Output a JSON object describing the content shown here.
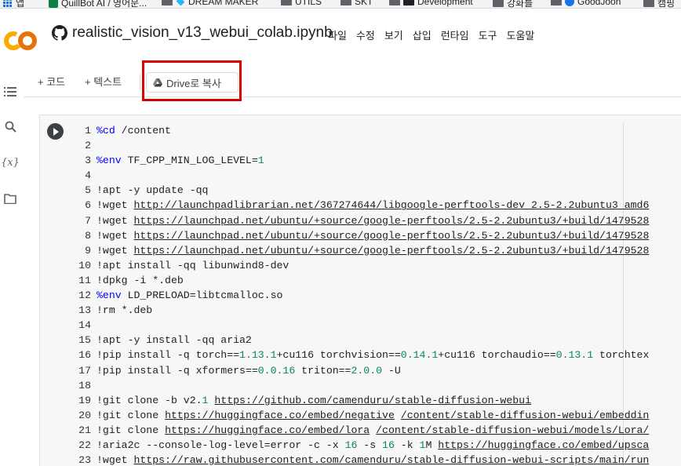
{
  "bookmarks": [
    {
      "label": "앱",
      "icon": "apps-grid-icon"
    },
    {
      "label": "QuillBot AI / 영어문...",
      "icon": "quillbot-icon"
    },
    {
      "label": "DREAM MAKER",
      "icon": "gem-icon"
    },
    {
      "label": "UTILS",
      "icon": "folder-icon"
    },
    {
      "label": "SKT",
      "icon": "folder-icon"
    },
    {
      "label": "Development",
      "icon": "laptop-icon"
    },
    {
      "label": "강화를",
      "icon": "folder-icon"
    },
    {
      "label": "GoodJoon",
      "icon": "user-icon"
    },
    {
      "label": "캠핑",
      "icon": "folder-icon"
    }
  ],
  "header": {
    "title": "realistic_vision_v13_webui_colab.ipynb",
    "menu": [
      "파일",
      "수정",
      "보기",
      "삽입",
      "런타임",
      "도구",
      "도움말"
    ]
  },
  "toolbar": {
    "add_code": "+ 코드",
    "add_text": "+ 텍스트",
    "copy_to_drive": "Drive로 복사"
  },
  "colors": {
    "highlight": "#d50000",
    "keyword": "#0000ff",
    "number": "#098658"
  },
  "code_lines": [
    [
      {
        "t": "kw",
        "v": "%cd"
      },
      {
        "t": "p",
        "v": " /content"
      }
    ],
    [],
    [
      {
        "t": "kw",
        "v": "%env"
      },
      {
        "t": "p",
        "v": " TF_CPP_MIN_LOG_LEVEL="
      },
      {
        "t": "num",
        "v": "1"
      }
    ],
    [],
    [
      {
        "t": "p",
        "v": "!apt -y update -qq"
      }
    ],
    [
      {
        "t": "p",
        "v": "!wget "
      },
      {
        "t": "url",
        "v": "http://launchpadlibrarian.net/"
      },
      {
        "t": "numurl",
        "v": "367274644"
      },
      {
        "t": "url",
        "v": "/libgoogle-perftools-dev_2."
      },
      {
        "t": "numurl",
        "v": "5"
      },
      {
        "t": "url",
        "v": "-"
      },
      {
        "t": "numurl",
        "v": "2.2"
      },
      {
        "t": "url",
        "v": "ubuntu3_amd6"
      }
    ],
    [
      {
        "t": "p",
        "v": "!wget "
      },
      {
        "t": "url",
        "v": "https://launchpad.net/ubuntu/+source/google-perftools/"
      },
      {
        "t": "numurl",
        "v": "2.5"
      },
      {
        "t": "url",
        "v": "-"
      },
      {
        "t": "numurl",
        "v": "2.2"
      },
      {
        "t": "url",
        "v": "ubuntu3/+build/1479528"
      }
    ],
    [
      {
        "t": "p",
        "v": "!wget "
      },
      {
        "t": "url",
        "v": "https://launchpad.net/ubuntu/+source/google-perftools/"
      },
      {
        "t": "numurl",
        "v": "2.5"
      },
      {
        "t": "url",
        "v": "-"
      },
      {
        "t": "numurl",
        "v": "2.2"
      },
      {
        "t": "url",
        "v": "ubuntu3/+build/1479528"
      }
    ],
    [
      {
        "t": "p",
        "v": "!wget "
      },
      {
        "t": "url",
        "v": "https://launchpad.net/ubuntu/+source/google-perftools/"
      },
      {
        "t": "numurl",
        "v": "2.5"
      },
      {
        "t": "url",
        "v": "-"
      },
      {
        "t": "numurl",
        "v": "2.2"
      },
      {
        "t": "url",
        "v": "ubuntu3/+build/1479528"
      }
    ],
    [
      {
        "t": "p",
        "v": "!apt install -qq libunwind8-dev"
      }
    ],
    [
      {
        "t": "p",
        "v": "!dpkg -i *.deb"
      }
    ],
    [
      {
        "t": "kw",
        "v": "%env"
      },
      {
        "t": "p",
        "v": " LD_PRELOAD=libtcmalloc.so"
      }
    ],
    [
      {
        "t": "p",
        "v": "!rm *.deb"
      }
    ],
    [],
    [
      {
        "t": "p",
        "v": "!apt -y install -qq aria2"
      }
    ],
    [
      {
        "t": "p",
        "v": "!pip install -q torch=="
      },
      {
        "t": "num",
        "v": "1.13.1"
      },
      {
        "t": "p",
        "v": "+cu116 torchvision=="
      },
      {
        "t": "num",
        "v": "0.14.1"
      },
      {
        "t": "p",
        "v": "+cu116 torchaudio=="
      },
      {
        "t": "num",
        "v": "0.13.1"
      },
      {
        "t": "p",
        "v": " torchtex"
      }
    ],
    [
      {
        "t": "p",
        "v": "!pip install -q xformers=="
      },
      {
        "t": "num",
        "v": "0.0.16"
      },
      {
        "t": "p",
        "v": " triton=="
      },
      {
        "t": "num",
        "v": "2.0.0"
      },
      {
        "t": "p",
        "v": " -U"
      }
    ],
    [],
    [
      {
        "t": "p",
        "v": "!git clone -b v2."
      },
      {
        "t": "num",
        "v": "1"
      },
      {
        "t": "p",
        "v": " "
      },
      {
        "t": "url",
        "v": "https://github.com/camenduru/stable-diffusion-webui"
      }
    ],
    [
      {
        "t": "p",
        "v": "!git clone "
      },
      {
        "t": "url",
        "v": "https://huggingface.co/embed/negative"
      },
      {
        "t": "p",
        "v": " "
      },
      {
        "t": "url",
        "v": "/content/stable-diffusion-webui/embeddin"
      }
    ],
    [
      {
        "t": "p",
        "v": "!git clone "
      },
      {
        "t": "url",
        "v": "https://huggingface.co/embed/lora"
      },
      {
        "t": "p",
        "v": " "
      },
      {
        "t": "url",
        "v": "/content/stable-diffusion-webui/models/Lora/"
      }
    ],
    [
      {
        "t": "p",
        "v": "!aria2c --console-log-level=error -c -x "
      },
      {
        "t": "num",
        "v": "16"
      },
      {
        "t": "p",
        "v": " -s "
      },
      {
        "t": "num",
        "v": "16"
      },
      {
        "t": "p",
        "v": " -k "
      },
      {
        "t": "num",
        "v": "1"
      },
      {
        "t": "p",
        "v": "M "
      },
      {
        "t": "url",
        "v": "https://huggingface.co/embed/upsca"
      }
    ],
    [
      {
        "t": "p",
        "v": "!wget "
      },
      {
        "t": "url",
        "v": "https://raw.githubusercontent.com/camenduru/stable-diffusion-webui-scripts/main/run"
      }
    ]
  ]
}
